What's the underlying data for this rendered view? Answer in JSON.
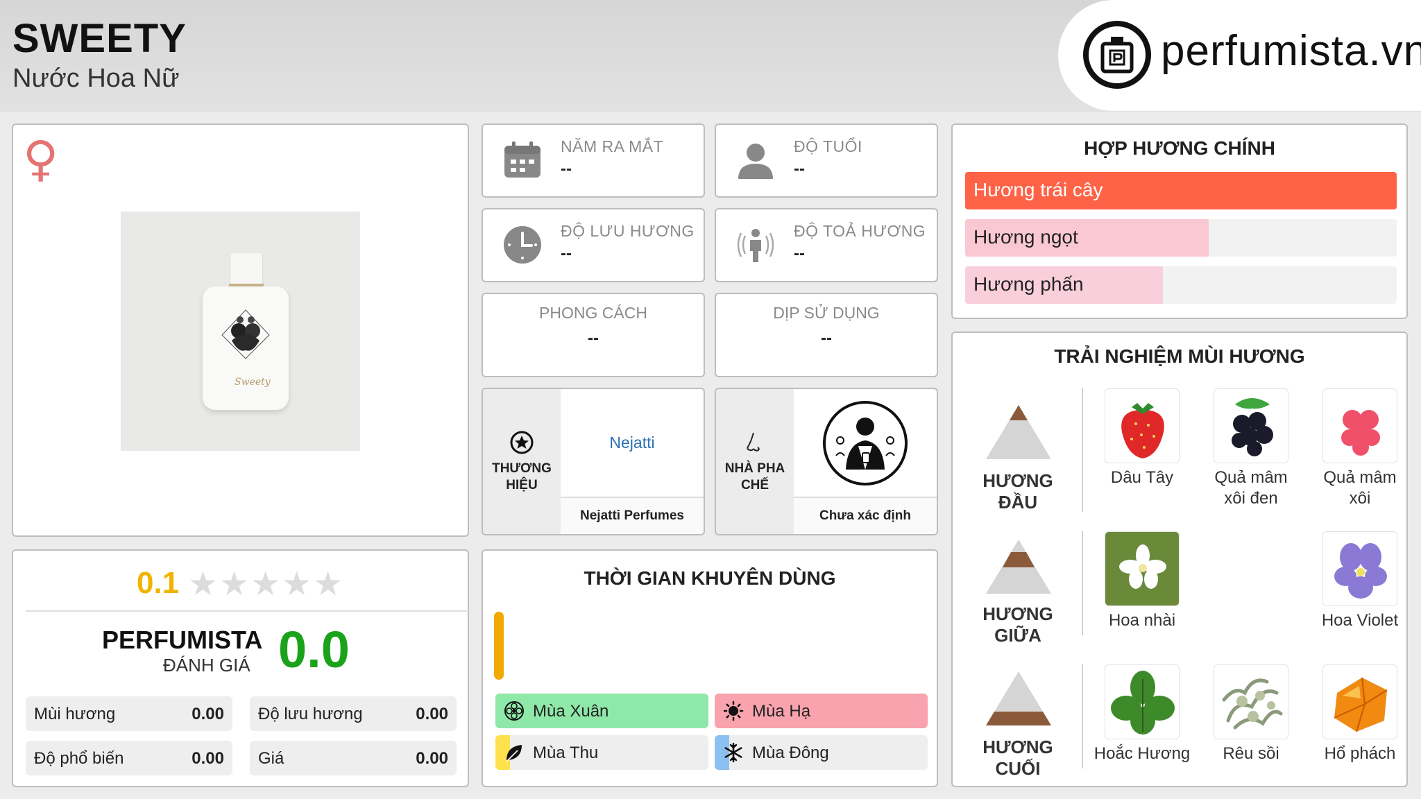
{
  "header": {
    "title": "SWEETY",
    "subtitle": "Nước Hoa Nữ",
    "logo_text": "perfumista.vn"
  },
  "product": {
    "gender_icon": "female-icon",
    "bottle_signature": "Sweety"
  },
  "info": {
    "release_year": {
      "label": "NĂM RA MẮT",
      "value": "--",
      "icon": "calendar-icon"
    },
    "age": {
      "label": "ĐỘ TUỔI",
      "value": "--",
      "icon": "user-icon"
    },
    "longevity": {
      "label": "ĐỘ LƯU HƯƠNG",
      "value": "--",
      "icon": "clock-icon"
    },
    "sillage": {
      "label": "ĐỘ TOẢ HƯƠNG",
      "value": "--",
      "icon": "radiate-icon"
    },
    "style": {
      "label": "PHONG CÁCH",
      "value": "--"
    },
    "occasion": {
      "label": "DỊP SỬ DỤNG",
      "value": "--"
    },
    "brand": {
      "label": "THƯƠNG HIỆU",
      "name": "Nejatti",
      "full_name": "Nejatti Perfumes",
      "icon": "star-badge-icon"
    },
    "perfumer": {
      "label": "NHÀ PHA CHẾ",
      "name": "Chưa xác định",
      "icon": "nose-icon"
    }
  },
  "accords": {
    "title": "HỢP HƯƠNG CHÍNH",
    "items": [
      {
        "label": "Hương trái cây",
        "fraction": 1.0,
        "color": "#ff6347"
      },
      {
        "label": "Hương ngọt",
        "fraction": 0.565,
        "color": "#f9c8d2"
      },
      {
        "label": "Hương phấn",
        "fraction": 0.458,
        "color": "#f9cfdb"
      }
    ]
  },
  "notes": {
    "title": "TRẢI NGHIỆM MÙI HƯƠNG",
    "top": {
      "label": "HƯƠNG ĐẦU",
      "items": [
        "Dâu Tây",
        "Quả mâm xôi đen",
        "Quả mâm xôi"
      ]
    },
    "middle": {
      "label": "HƯƠNG GIỮA",
      "items": [
        "Hoa nhài",
        "Hoa Violet"
      ]
    },
    "base": {
      "label": "HƯƠNG CUỐI",
      "items": [
        "Hoắc Hương",
        "Rêu sồi",
        "Hổ phách"
      ]
    }
  },
  "rating": {
    "user_score": "0.1",
    "user_score_value": 0.1,
    "stars_total": 5,
    "perfumista_title": "PERFUMISTA",
    "perfumista_sub": "ĐÁNH GIÁ",
    "perfumista_score": "0.0",
    "metrics": [
      {
        "label": "Mùi hương",
        "value": "0.00"
      },
      {
        "label": "Độ lưu hương",
        "value": "0.00"
      },
      {
        "label": "Độ phổ biến",
        "value": "0.00"
      },
      {
        "label": "Giá",
        "value": "0.00"
      }
    ]
  },
  "time": {
    "title": "THỜI GIAN KHUYÊN DÙNG",
    "day_bar_color": "#f2a900",
    "seasons": [
      {
        "label": "Mùa Xuân",
        "icon": "flower-icon",
        "fraction": 1.0,
        "color": "#8ee8a8"
      },
      {
        "label": "Mùa Hạ",
        "icon": "sun-icon",
        "fraction": 1.0,
        "color": "#f8a3ad"
      },
      {
        "label": "Mùa Thu",
        "icon": "leaf-icon",
        "fraction": 0.07,
        "color": "#ffe14d"
      },
      {
        "label": "Mùa Đông",
        "icon": "snowflake-icon",
        "fraction": 0.07,
        "color": "#8cc0f0"
      }
    ]
  }
}
